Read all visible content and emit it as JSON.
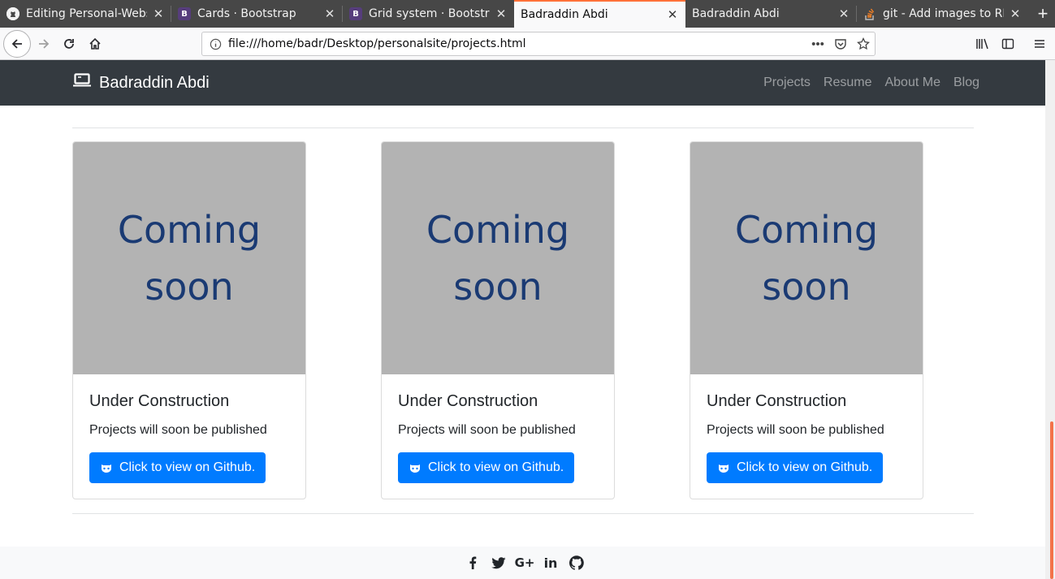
{
  "browser": {
    "tabs": [
      {
        "label": "Editing Personal-Webs",
        "favicon": "github-icon"
      },
      {
        "label": "Cards · Bootstrap",
        "favicon": "bootstrap-icon",
        "favicon_letter": "B"
      },
      {
        "label": "Grid system · Bootstra",
        "favicon": "bootstrap-icon",
        "favicon_letter": "B"
      },
      {
        "label": "Badraddin Abdi",
        "favicon": "none",
        "active": true
      },
      {
        "label": "Badraddin Abdi",
        "favicon": "none"
      },
      {
        "label": "git - Add images to RE",
        "favicon": "stackoverflow-icon"
      }
    ],
    "url": "file:///home/badr/Desktop/personalsite/projects.html",
    "accent": "#ff7139"
  },
  "site": {
    "brand": "Badraddin Abdi",
    "nav": [
      "Projects",
      "Resume",
      "About Me",
      "Blog"
    ],
    "cards": [
      {
        "image_text": [
          "Coming",
          "soon"
        ],
        "title": "Under Construction",
        "text": "Projects will soon be published",
        "button": "Click to view on Github."
      },
      {
        "image_text": [
          "Coming",
          "soon"
        ],
        "title": "Under Construction",
        "text": "Projects will soon be published",
        "button": "Click to view on Github."
      },
      {
        "image_text": [
          "Coming",
          "soon"
        ],
        "title": "Under Construction",
        "text": "Projects will soon be published",
        "button": "Click to view on Github."
      }
    ],
    "social": [
      "facebook-icon",
      "twitter-icon",
      "google-plus-icon",
      "linkedin-icon",
      "github-icon"
    ],
    "colors": {
      "navbar": "#343a40",
      "primary": "#007bff",
      "placeholder": "#b3b3b3",
      "placeholder_text": "#1a3a73"
    }
  }
}
